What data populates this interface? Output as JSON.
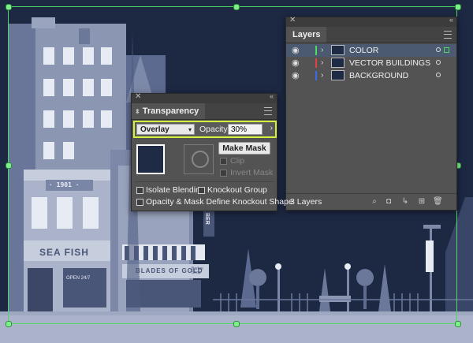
{
  "artwork": {
    "sign_year": "· 1901 ·",
    "sign_fish": "SEA FISH",
    "sign_blades": "BLADES OF GOLD",
    "sign_open": "OPEN 24/7",
    "sign_vertical": "BER",
    "sign_barber": "Barber Shop"
  },
  "layers_panel": {
    "tab": "Layers",
    "layers": [
      {
        "name": "COLOR",
        "color": "#4cd964",
        "selected": true
      },
      {
        "name": "VECTOR BUILDINGS",
        "color": "#e0443e",
        "selected": false
      },
      {
        "name": "BACKGROUND",
        "color": "#3a6ee8",
        "selected": false
      }
    ],
    "count_label": "3 Layers",
    "footer_icons": [
      "search-icon",
      "clipping-mask-icon",
      "sublayer-icon",
      "new-layer-icon",
      "trash-icon"
    ]
  },
  "transparency_panel": {
    "tab": "Transparency",
    "blend_mode": "Overlay",
    "opacity_label": "Opacity:",
    "opacity_value": "30%",
    "make_mask": "Make Mask",
    "clip": "Clip",
    "invert_mask": "Invert Mask",
    "isolate_blending": "Isolate Blending",
    "knockout_group": "Knockout Group",
    "opacity_mask_knockout": "Opacity & Mask Define Knockout Shape"
  },
  "colors": {
    "selection": "#4cd964",
    "highlight": "#d7f23a",
    "sky": "#1d2843",
    "panel": "#535353"
  }
}
